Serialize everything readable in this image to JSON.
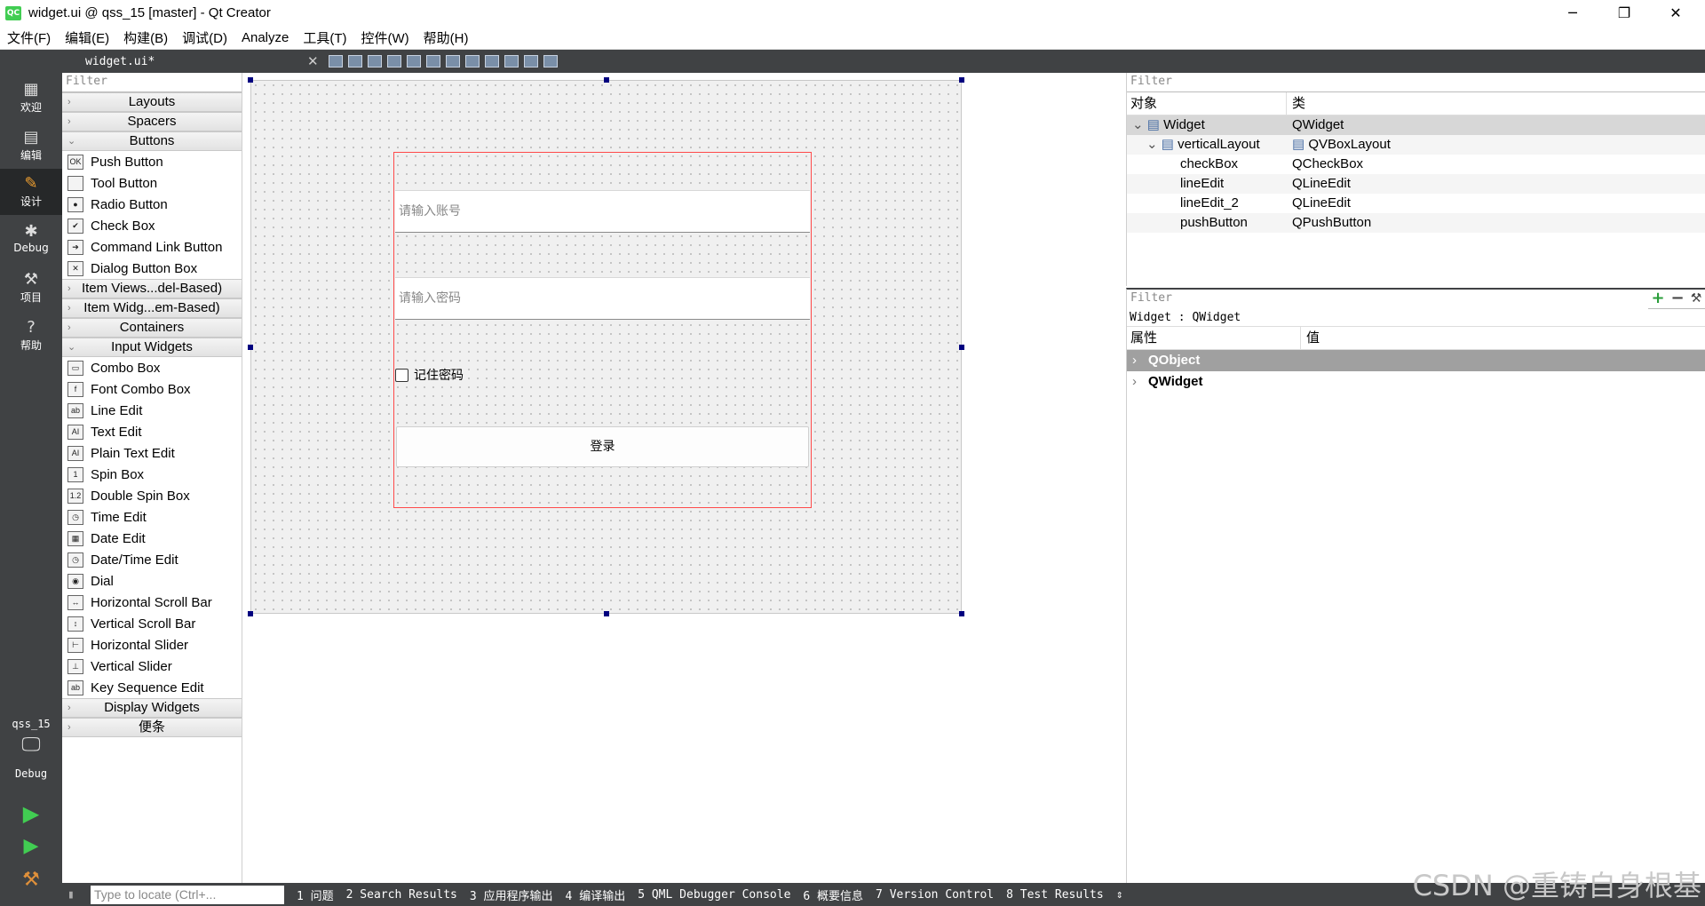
{
  "window": {
    "title": "widget.ui @ qss_15 [master] - Qt Creator",
    "app_icon": "QC",
    "minimize": "─",
    "restore": "❐",
    "close": "✕"
  },
  "menu": [
    "文件(F)",
    "编辑(E)",
    "构建(B)",
    "调试(D)",
    "Analyze",
    "工具(T)",
    "控件(W)",
    "帮助(H)"
  ],
  "modes": [
    {
      "label": "欢迎",
      "icon": "grid-icon"
    },
    {
      "label": "编辑",
      "icon": "edit-icon"
    },
    {
      "label": "设计",
      "icon": "pencil-icon"
    },
    {
      "label": "Debug",
      "icon": "bug-icon"
    },
    {
      "label": "项目",
      "icon": "wrench-icon"
    },
    {
      "label": "帮助",
      "icon": "help-icon"
    }
  ],
  "kit": {
    "project": "qss_15",
    "config": "Debug"
  },
  "editor": {
    "file": "widget.ui*",
    "close": "✕"
  },
  "widgetbox": {
    "filter": "Filter",
    "cats_top": [
      "Layouts",
      "Spacers",
      "Buttons"
    ],
    "buttons": [
      {
        "label": "Push Button",
        "ic": "OK"
      },
      {
        "label": "Tool Button",
        "ic": ""
      },
      {
        "label": "Radio Button",
        "ic": "●"
      },
      {
        "label": "Check Box",
        "ic": "✔"
      },
      {
        "label": "Command Link Button",
        "ic": "➔"
      },
      {
        "label": "Dialog Button Box",
        "ic": "✕"
      }
    ],
    "cats_mid": [
      "Item Views...del-Based)",
      "Item Widg...em-Based)",
      "Containers",
      "Input Widgets"
    ],
    "inputs": [
      {
        "label": "Combo Box",
        "ic": "▭"
      },
      {
        "label": "Font Combo Box",
        "ic": "f"
      },
      {
        "label": "Line Edit",
        "ic": "ab"
      },
      {
        "label": "Text Edit",
        "ic": "AI"
      },
      {
        "label": "Plain Text Edit",
        "ic": "AI"
      },
      {
        "label": "Spin Box",
        "ic": "1"
      },
      {
        "label": "Double Spin Box",
        "ic": "1.2"
      },
      {
        "label": "Time Edit",
        "ic": "◷"
      },
      {
        "label": "Date Edit",
        "ic": "▦"
      },
      {
        "label": "Date/Time Edit",
        "ic": "◷"
      },
      {
        "label": "Dial",
        "ic": "◉"
      },
      {
        "label": "Horizontal Scroll Bar",
        "ic": "↔"
      },
      {
        "label": "Vertical Scroll Bar",
        "ic": "↕"
      },
      {
        "label": "Horizontal Slider",
        "ic": "⊢"
      },
      {
        "label": "Vertical Slider",
        "ic": "⊥"
      },
      {
        "label": "Key Sequence Edit",
        "ic": "ab"
      }
    ],
    "cats_bottom": [
      "Display Widgets",
      "便条"
    ]
  },
  "form": {
    "username_placeholder": "请输入账号",
    "password_placeholder": "请输入密码",
    "remember": "记住密码",
    "login": "登录"
  },
  "objinsp": {
    "filter": "Filter",
    "col_object": "对象",
    "col_class": "类",
    "rows": [
      {
        "name": "Widget",
        "cls": "QWidget",
        "indent": 0
      },
      {
        "name": "verticalLayout",
        "cls": "QVBoxLayout",
        "indent": 1
      },
      {
        "name": "checkBox",
        "cls": "QCheckBox",
        "indent": 2
      },
      {
        "name": "lineEdit",
        "cls": "QLineEdit",
        "indent": 2
      },
      {
        "name": "lineEdit_2",
        "cls": "QLineEdit",
        "indent": 2
      },
      {
        "name": "pushButton",
        "cls": "QPushButton",
        "indent": 2
      }
    ]
  },
  "propinsp": {
    "filter": "Filter",
    "context": "Widget : QWidget",
    "col_prop": "属性",
    "col_val": "值",
    "groups": [
      "QObject",
      "QWidget"
    ]
  },
  "bottom": {
    "locate": "Type to locate (Ctrl+...",
    "tabs": [
      "1 问题",
      "2 Search Results",
      "3 应用程序输出",
      "4 编译输出",
      "5 QML Debugger Console",
      "6 概要信息",
      "7 Version Control",
      "8 Test Results"
    ]
  },
  "watermark": "CSDN @重铸自身根基"
}
